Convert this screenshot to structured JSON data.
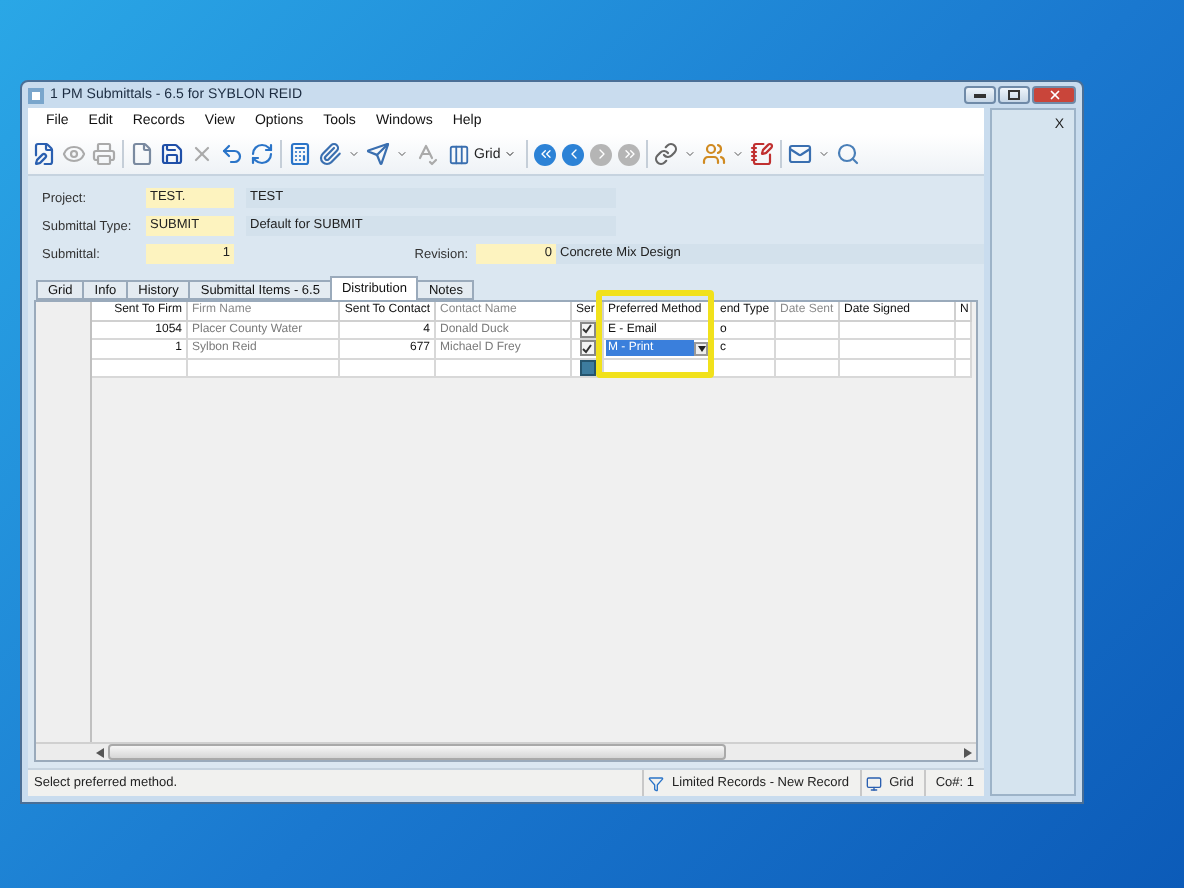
{
  "window": {
    "title": "1 PM Submittals - 6.5 for SYBLON REID"
  },
  "menu": [
    "File",
    "Edit",
    "Records",
    "View",
    "Options",
    "Tools",
    "Windows",
    "Help"
  ],
  "toolbar": {
    "view_label": "Grid"
  },
  "header": {
    "project_label": "Project:",
    "project_code": "TEST.",
    "project_name": "TEST",
    "type_label": "Submittal Type:",
    "type_code": "SUBMIT",
    "type_name": "Default for SUBMIT",
    "submittal_label": "Submittal:",
    "submittal_number": "1",
    "revision_label": "Revision:",
    "revision_number": "0",
    "description": "Concrete Mix Design"
  },
  "tabs": [
    {
      "label": "Grid",
      "selected": false
    },
    {
      "label": "Info",
      "selected": false
    },
    {
      "label": "History",
      "selected": false
    },
    {
      "label": "Submittal Items - 6.5",
      "selected": false
    },
    {
      "label": "Distribution",
      "selected": true
    },
    {
      "label": "Notes",
      "selected": false
    }
  ],
  "table": {
    "columns": [
      {
        "label": "Sent To Firm",
        "readonly": false
      },
      {
        "label": "Firm Name",
        "readonly": true
      },
      {
        "label": "Sent To Contact",
        "readonly": false
      },
      {
        "label": "Contact Name",
        "readonly": true
      },
      {
        "label": "Ser",
        "readonly": false
      },
      {
        "label": "Preferred Method",
        "readonly": false
      },
      {
        "label": "end Type",
        "readonly": false
      },
      {
        "label": "Date Sent",
        "readonly": true
      },
      {
        "label": "Date Signed",
        "readonly": false
      },
      {
        "label": "N",
        "readonly": false
      }
    ],
    "rows": [
      {
        "kind": "record",
        "sent_to_firm": "1054",
        "firm_name": "Placer County Water",
        "sent_to_contact": "4",
        "contact_name": "Donald  Duck",
        "sent": true,
        "preferred_method": "E - Email",
        "method_selected": false,
        "send_type": "o"
      },
      {
        "kind": "record",
        "sent_to_firm": "1",
        "firm_name": "Sylbon Reid",
        "sent_to_contact": "677",
        "contact_name": "Michael D Frey",
        "sent": true,
        "preferred_method": "M - Print",
        "method_selected": true,
        "send_type": "c"
      },
      {
        "kind": "new"
      }
    ]
  },
  "side_panel": {
    "close": "X"
  },
  "status_bar": {
    "message": "Select preferred method.",
    "records": "Limited Records - New Record",
    "view": "Grid",
    "company": "Co#: 1"
  }
}
